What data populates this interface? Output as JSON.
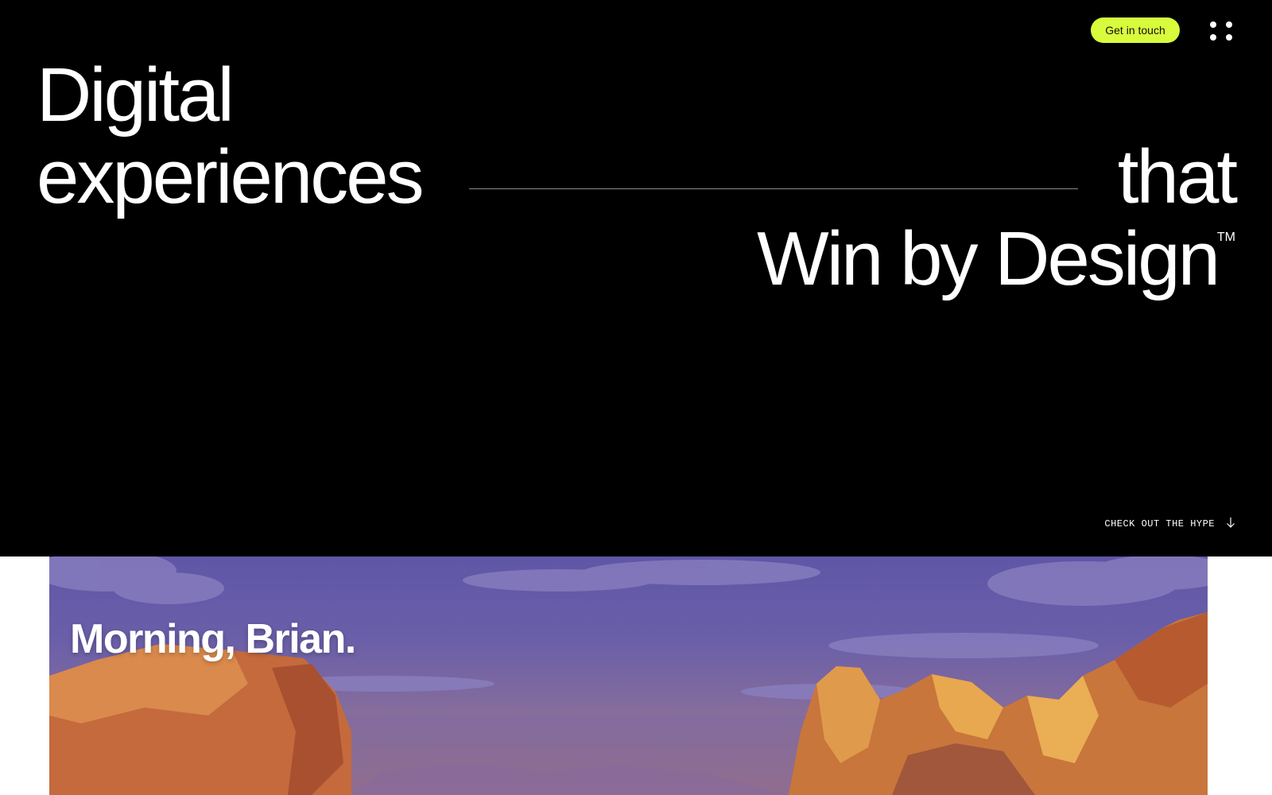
{
  "header": {
    "cta_label": "Get in touch",
    "menu_icon": "grid-dots-icon"
  },
  "hero": {
    "line1": "Digital",
    "line2_left": "experiences",
    "line2_right": "that",
    "line3": "Win by Design",
    "trademark": "TM",
    "scroll_label": "CHECK OUT THE HYPE",
    "scroll_icon": "arrow-down-icon"
  },
  "showcase": {
    "greeting": "Morning, Brian."
  },
  "colors": {
    "hero_bg": "#000000",
    "accent": "#d8fb3c",
    "text": "#ffffff"
  }
}
